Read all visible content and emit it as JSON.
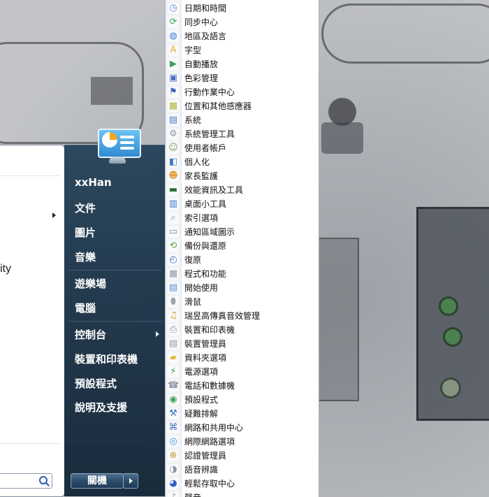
{
  "start_menu": {
    "left_pane": {
      "pinned_text_fragment": "ity",
      "search_placeholder": ""
    },
    "right_pane": {
      "user_name": "xxHan",
      "items": [
        "文件",
        "圖片",
        "音樂",
        "遊樂場",
        "電腦",
        "控制台",
        "裝置和印表機",
        "預設程式",
        "說明及支援"
      ],
      "shutdown_label": "關機"
    }
  },
  "control_panel_items": [
    {
      "label": "日期和時間",
      "icon": "calendar-clock-icon",
      "color": "#5b8fd6"
    },
    {
      "label": "同步中心",
      "icon": "sync-icon",
      "color": "#2fa84f"
    },
    {
      "label": "地區及語言",
      "icon": "globe-icon",
      "color": "#3a7bd5"
    },
    {
      "label": "字型",
      "icon": "font-icon",
      "color": "#e0b23a"
    },
    {
      "label": "自動播放",
      "icon": "autoplay-icon",
      "color": "#3f9e58"
    },
    {
      "label": "色彩管理",
      "icon": "color-management-icon",
      "color": "#4a6ec8"
    },
    {
      "label": "行動作業中心",
      "icon": "flag-icon",
      "color": "#3b64c4"
    },
    {
      "label": "位置和其他感應器",
      "icon": "sensor-icon",
      "color": "#b5b23c"
    },
    {
      "label": "系統",
      "icon": "system-icon",
      "color": "#4b79c9"
    },
    {
      "label": "系統管理工具",
      "icon": "admin-tools-icon",
      "color": "#8d9bab"
    },
    {
      "label": "使用者帳戶",
      "icon": "users-icon",
      "color": "#7aa04a"
    },
    {
      "label": "個人化",
      "icon": "personalization-icon",
      "color": "#3c7ec7"
    },
    {
      "label": "家長監護",
      "icon": "parental-controls-icon",
      "color": "#e0a13a"
    },
    {
      "label": "效能資訊及工具",
      "icon": "performance-icon",
      "color": "#2f6f3a"
    },
    {
      "label": "桌面小工具",
      "icon": "gadgets-icon",
      "color": "#3a77c8"
    },
    {
      "label": "索引選項",
      "icon": "index-icon",
      "color": "#8a94a3"
    },
    {
      "label": "通知區域圖示",
      "icon": "notification-icon",
      "color": "#7b8796"
    },
    {
      "label": "備份與還原",
      "icon": "backup-icon",
      "color": "#5aaa3c"
    },
    {
      "label": "復原",
      "icon": "recovery-icon",
      "color": "#3b6fcb"
    },
    {
      "label": "程式和功能",
      "icon": "programs-icon",
      "color": "#8b9aa9"
    },
    {
      "label": "開始使用",
      "icon": "getting-started-icon",
      "color": "#4d8ed4"
    },
    {
      "label": "滑鼠",
      "icon": "mouse-icon",
      "color": "#9aa3ad"
    },
    {
      "label": "瑞昱高傳真音效管理",
      "icon": "audio-manager-icon",
      "color": "#d6a02c"
    },
    {
      "label": "裝置和印表機",
      "icon": "printer-icon",
      "color": "#7f8c99"
    },
    {
      "label": "裝置管理員",
      "icon": "device-manager-icon",
      "color": "#8d98a5"
    },
    {
      "label": "資料夾選項",
      "icon": "folder-options-icon",
      "color": "#e7b838"
    },
    {
      "label": "電源選項",
      "icon": "power-icon",
      "color": "#3a9a4a"
    },
    {
      "label": "電話和數據機",
      "icon": "phone-modem-icon",
      "color": "#8893a1"
    },
    {
      "label": "預設程式",
      "icon": "default-programs-icon",
      "color": "#3aa24e"
    },
    {
      "label": "疑難排解",
      "icon": "troubleshoot-icon",
      "color": "#3a72c6"
    },
    {
      "label": "網路和共用中心",
      "icon": "network-icon",
      "color": "#3d6fc4"
    },
    {
      "label": "網際網路選項",
      "icon": "internet-options-icon",
      "color": "#3d8fd0"
    },
    {
      "label": "認證管理員",
      "icon": "credential-icon",
      "color": "#c79a32"
    },
    {
      "label": "語音辨識",
      "icon": "microphone-icon",
      "color": "#8a96a4"
    },
    {
      "label": "輕鬆存取中心",
      "icon": "ease-of-access-icon",
      "color": "#2f63c4"
    },
    {
      "label": "聲音",
      "icon": "sound-icon",
      "color": "#8c97a3"
    }
  ]
}
